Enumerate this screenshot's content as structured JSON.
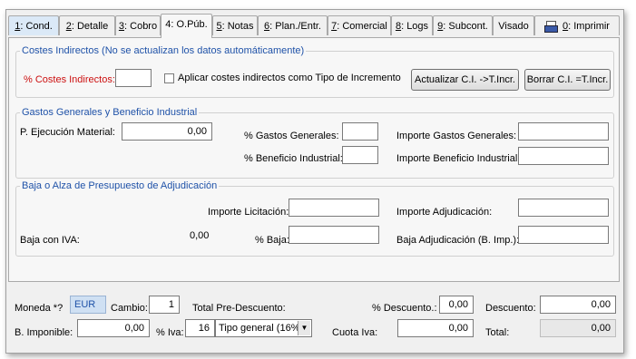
{
  "tabs": [
    {
      "key": "1",
      "label": ": Cond."
    },
    {
      "key": "2",
      "label": ": Detalle"
    },
    {
      "key": "3",
      "label": ": Cobro"
    },
    {
      "key": "4",
      "label": ": O.Púb."
    },
    {
      "key": "5",
      "label": ": Notas"
    },
    {
      "key": "6",
      "label": ": Plan./Entr."
    },
    {
      "key": "7",
      "label": ": Comercial"
    },
    {
      "key": "8",
      "label": ": Logs"
    },
    {
      "key": "9",
      "label": ": Subcont."
    },
    {
      "key": "",
      "label": "Visado"
    },
    {
      "key": "0",
      "label": ": Imprimir"
    }
  ],
  "costes": {
    "legend": "Costes Indirectos (No se actualizan los datos automáticamente)",
    "pct_label": "% Costes Indirectos:",
    "pct_value": "",
    "checkbox_label": "Aplicar costes indirectos como Tipo de Incremento",
    "btn_update": "Actualizar C.I. ->T.Incr.",
    "btn_delete": "Borrar C.I. =T.Incr."
  },
  "gastos": {
    "legend": "Gastos Generales y Beneficio Industrial",
    "pem_label": "P. Ejecución Material:",
    "pem_value": "0,00",
    "pct_gg_label": "% Gastos Generales:",
    "pct_gg_value": "",
    "pct_bi_label": "% Beneficio Industrial:",
    "pct_bi_value": "",
    "imp_gg_label": "Importe Gastos Generales:",
    "imp_gg_value": "",
    "imp_bi_label": "Importe Beneficio Industrial:",
    "imp_bi_value": ""
  },
  "baja": {
    "legend": "Baja o Alza de Presupuesto de Adjudicación",
    "imp_lic_label": "Importe Licitación:",
    "imp_lic_value": "",
    "imp_adj_label": "Importe Adjudicación:",
    "imp_adj_value": "",
    "baja_iva_label": "Baja con IVA:",
    "baja_iva_value": "0,00",
    "pct_baja_label": "% Baja:",
    "pct_baja_value": "",
    "baja_adj_label": "Baja Adjudicación (B. Imp.):",
    "baja_adj_value": ""
  },
  "footer": {
    "moneda_label": "Moneda *?",
    "moneda_value": "EUR",
    "cambio_label": "Cambio:",
    "cambio_value": "1",
    "total_pre_label": "Total Pre-Descuento:",
    "pct_desc_label": "% Descuento.:",
    "pct_desc_value": "0,00",
    "descuento_label": "Descuento:",
    "descuento_value": "0,00",
    "bimp_label": "B. Imponible:",
    "bimp_value": "0,00",
    "pct_iva_label": "% Iva:",
    "pct_iva_value": "16",
    "tipo_iva_value": "Tipo general (16%",
    "cuota_label": "Cuota Iva:",
    "cuota_value": "0,00",
    "total_label": "Total:",
    "total_value": "0,00"
  }
}
